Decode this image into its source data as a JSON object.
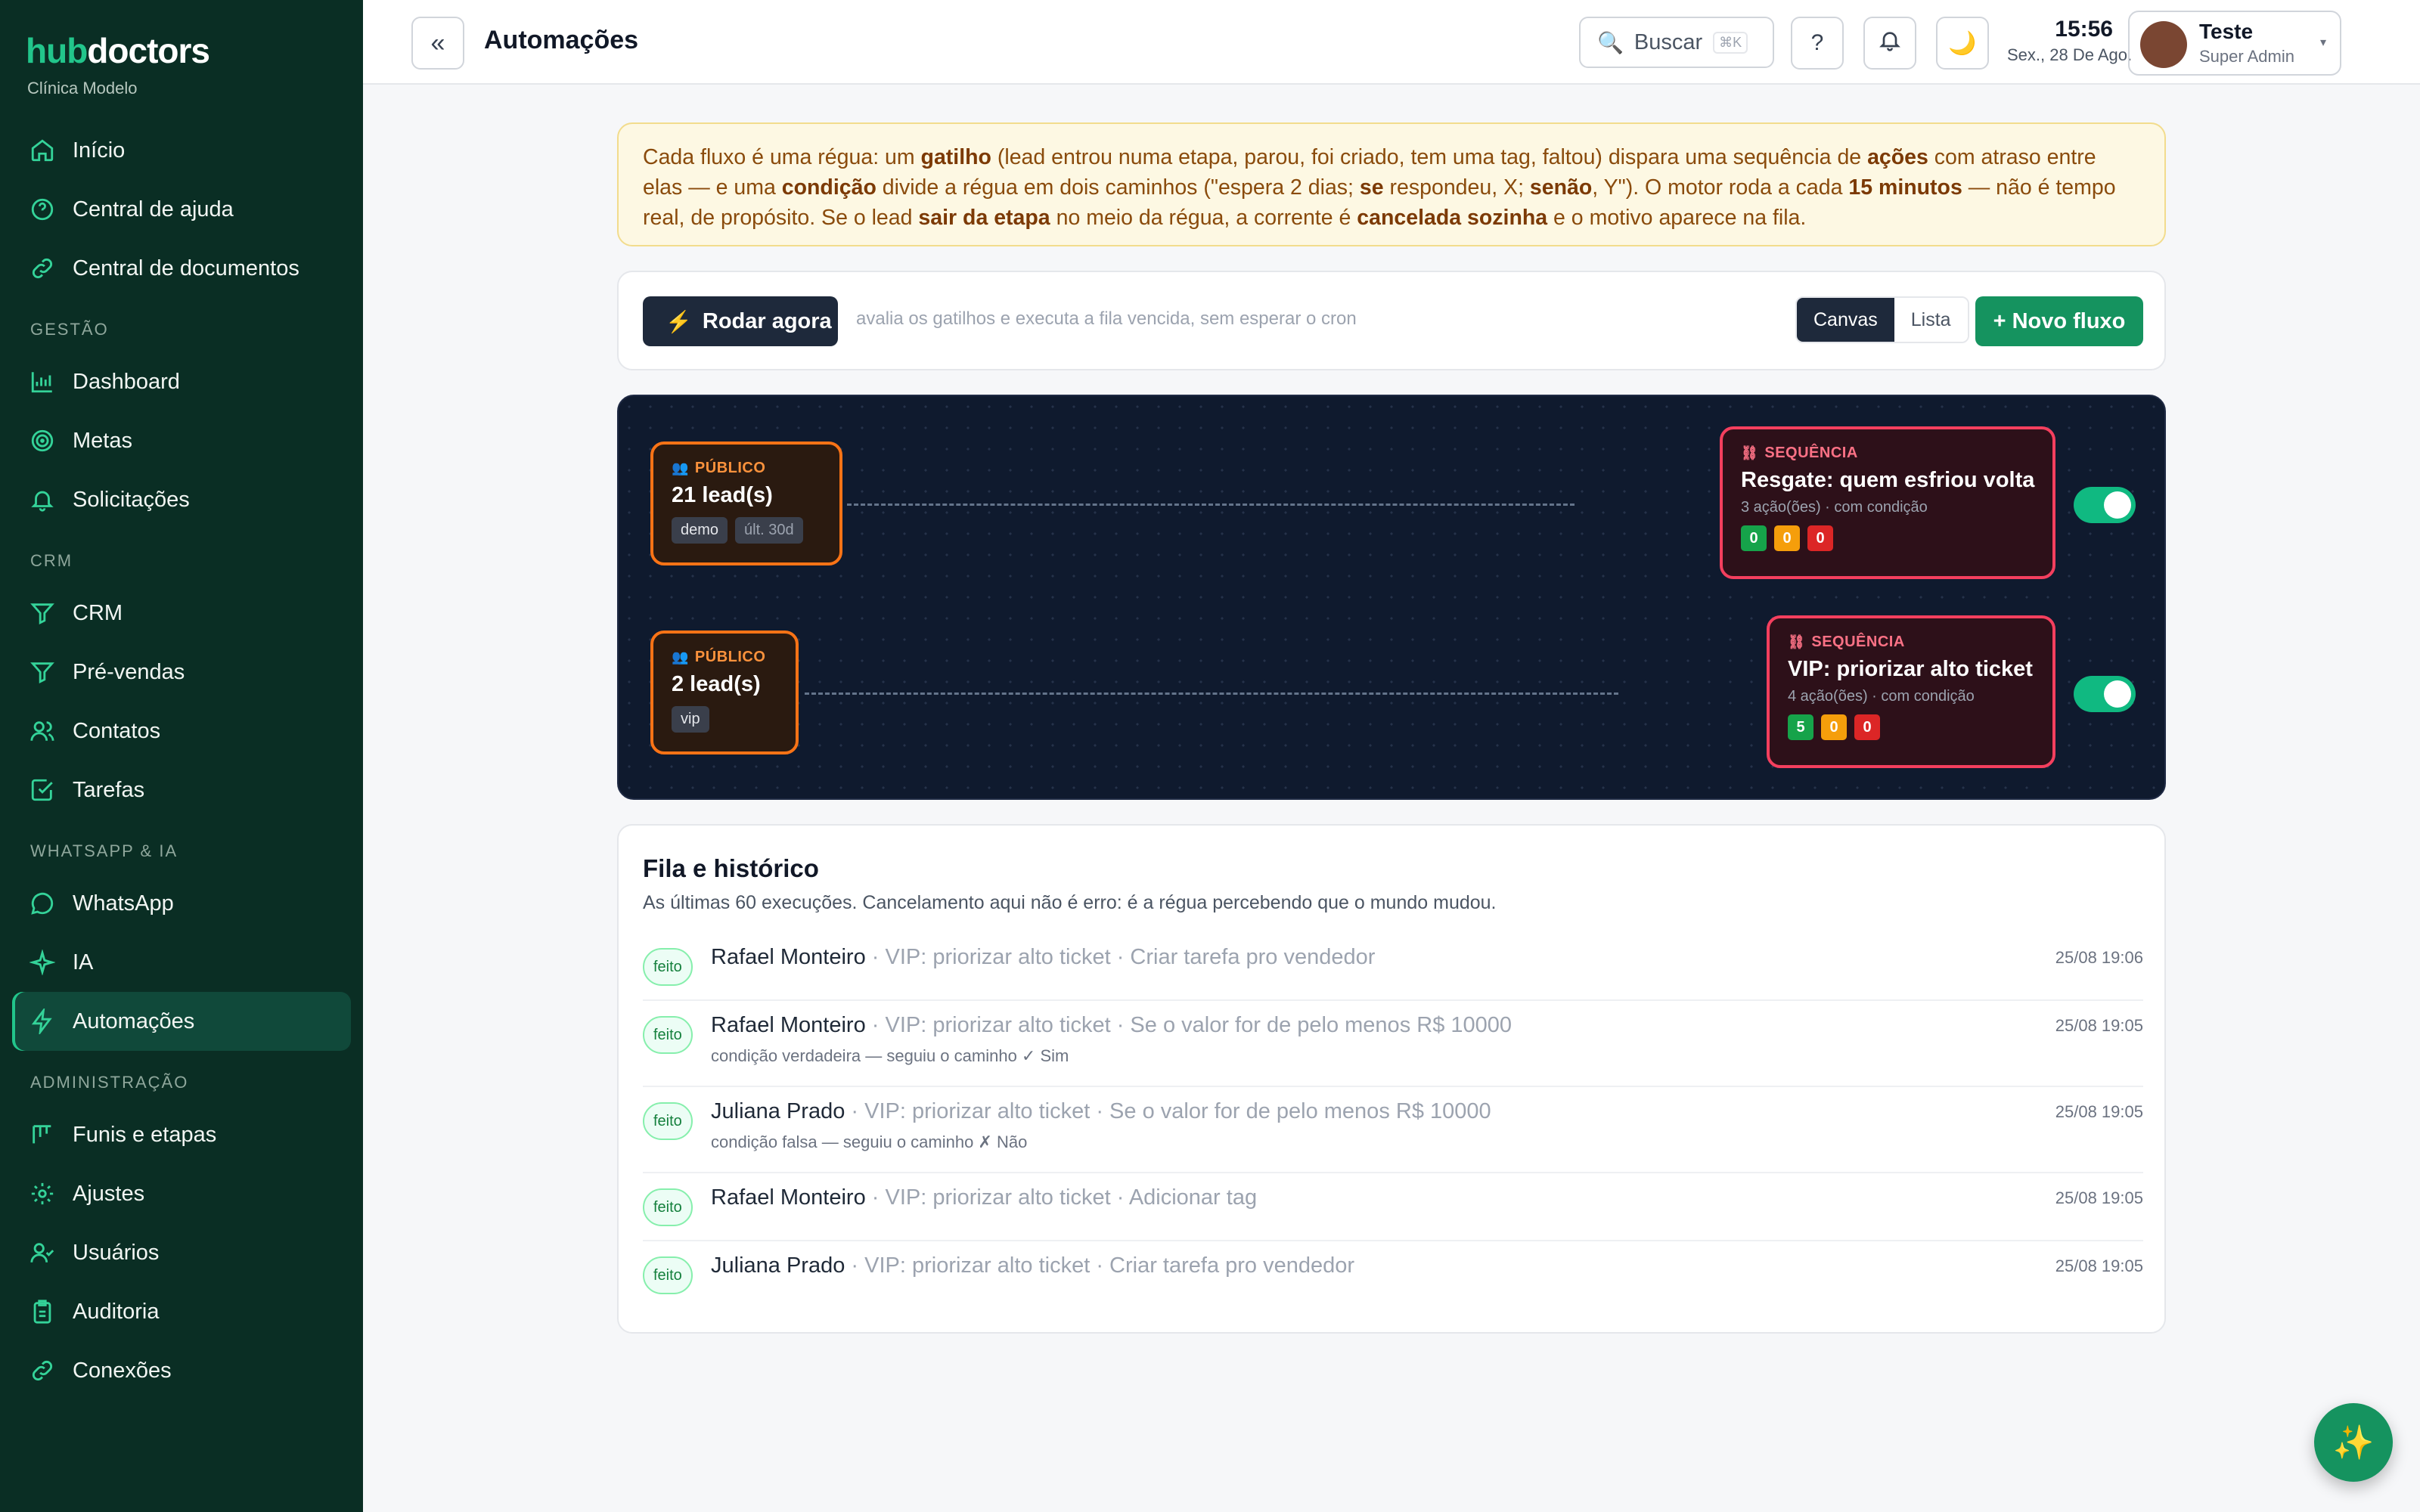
{
  "brand": {
    "part1": "hub",
    "part2": "doctors",
    "clinic": "Clínica Modelo"
  },
  "sidebar": {
    "top_items": [
      {
        "label": "Início",
        "icon": "home-icon"
      },
      {
        "label": "Central de ajuda",
        "icon": "help-circle-icon"
      },
      {
        "label": "Central de documentos",
        "icon": "link-icon"
      }
    ],
    "sections": [
      {
        "title": "GESTÃO",
        "items": [
          {
            "label": "Dashboard",
            "icon": "bar-chart-icon"
          },
          {
            "label": "Metas",
            "icon": "target-icon"
          },
          {
            "label": "Solicitações",
            "icon": "bell-icon"
          }
        ]
      },
      {
        "title": "CRM",
        "items": [
          {
            "label": "CRM",
            "icon": "filter-icon"
          },
          {
            "label": "Pré-vendas",
            "icon": "filter-icon"
          },
          {
            "label": "Contatos",
            "icon": "users-icon"
          },
          {
            "label": "Tarefas",
            "icon": "check-square-icon"
          }
        ]
      },
      {
        "title": "WHATSAPP & IA",
        "items": [
          {
            "label": "WhatsApp",
            "icon": "message-circle-icon"
          },
          {
            "label": "IA",
            "icon": "sparkle-icon"
          },
          {
            "label": "Automações",
            "icon": "zap-icon",
            "active": true
          }
        ]
      },
      {
        "title": "ADMINISTRAÇÃO",
        "items": [
          {
            "label": "Funis e etapas",
            "icon": "kanban-icon"
          },
          {
            "label": "Ajustes",
            "icon": "gear-icon"
          },
          {
            "label": "Usuários",
            "icon": "user-check-icon"
          },
          {
            "label": "Auditoria",
            "icon": "clipboard-icon"
          },
          {
            "label": "Conexões",
            "icon": "link-icon"
          }
        ]
      }
    ]
  },
  "topbar": {
    "collapse_icon": "«",
    "title": "Automações",
    "search_label": "Buscar",
    "search_shortcut": "⌘K",
    "help_label": "?",
    "theme_icon": "🌙",
    "time": "15:56",
    "date": "Sex., 28 De Ago.",
    "user_name": "Teste",
    "user_role": "Super Admin"
  },
  "info": {
    "t1": "Cada fluxo é uma régua: um ",
    "b1": "gatilho",
    "t2": " (lead entrou numa etapa, parou, foi criado, tem uma tag, faltou) dispara uma sequência de ",
    "b2": "ações",
    "t3": " com atraso entre elas — e uma ",
    "b3": "condição",
    "t4": " divide a régua em dois caminhos (\"espera 2 dias; ",
    "b4": "se",
    "t5": " respondeu, X; ",
    "b5": "senão",
    "t6": ", Y\"). O motor roda a cada ",
    "b6": "15 minutos",
    "t7": " — não é tempo real, de propósito. Se o lead ",
    "b7": "sair da etapa",
    "t8": " no meio da régua, a corrente é ",
    "b8": "cancelada sozinha",
    "t9": " e o motivo aparece na fila."
  },
  "toolbar": {
    "run_label": "Rodar agora",
    "hint": "avalia os gatilhos e executa a fila vencida, sem esperar o cron",
    "view_canvas": "Canvas",
    "view_list": "Lista",
    "new_flow": "+ Novo fluxo"
  },
  "flows": [
    {
      "public": {
        "kind": "PÚBLICO",
        "count": "21 lead(s)",
        "tags": [
          "demo",
          "últ. 30d"
        ]
      },
      "sequence": {
        "kind": "SEQUÊNCIA",
        "name": "Resgate: quem esfriou volta",
        "meta": "3 ação(ões) · com condição",
        "done": "0",
        "pending": "0",
        "errors": "0"
      },
      "enabled": true
    },
    {
      "public": {
        "kind": "PÚBLICO",
        "count": "2 lead(s)",
        "tags": [
          "vip"
        ]
      },
      "sequence": {
        "kind": "SEQUÊNCIA",
        "name": "VIP: priorizar alto ticket",
        "meta": "4 ação(ões) · com condição",
        "done": "5",
        "pending": "0",
        "errors": "0"
      },
      "enabled": true
    }
  ],
  "history": {
    "title": "Fila e histórico",
    "subtitle": "As últimas 60 execuções. Cancelamento aqui não é erro: é a régua percebendo que o mundo mudou.",
    "rows": [
      {
        "status": "feito",
        "who": "Rafael Monteiro",
        "what": " · VIP: priorizar alto ticket · Criar tarefa pro vendedor",
        "detail": "",
        "time": "25/08 19:06"
      },
      {
        "status": "feito",
        "who": "Rafael Monteiro",
        "what": " · VIP: priorizar alto ticket · Se o valor for de pelo menos R$ 10000",
        "detail": "condição verdadeira — seguiu o caminho ✓ Sim",
        "time": "25/08 19:05"
      },
      {
        "status": "feito",
        "who": "Juliana Prado",
        "what": " · VIP: priorizar alto ticket · Se o valor for de pelo menos R$ 10000",
        "detail": "condição falsa — seguiu o caminho ✗ Não",
        "time": "25/08 19:05"
      },
      {
        "status": "feito",
        "who": "Rafael Monteiro",
        "what": " · VIP: priorizar alto ticket · Adicionar tag",
        "detail": "",
        "time": "25/08 19:05"
      },
      {
        "status": "feito",
        "who": "Juliana Prado",
        "what": " · VIP: priorizar alto ticket · Criar tarefa pro vendedor",
        "detail": "",
        "time": "25/08 19:05"
      }
    ]
  },
  "fab_icon": "✨"
}
